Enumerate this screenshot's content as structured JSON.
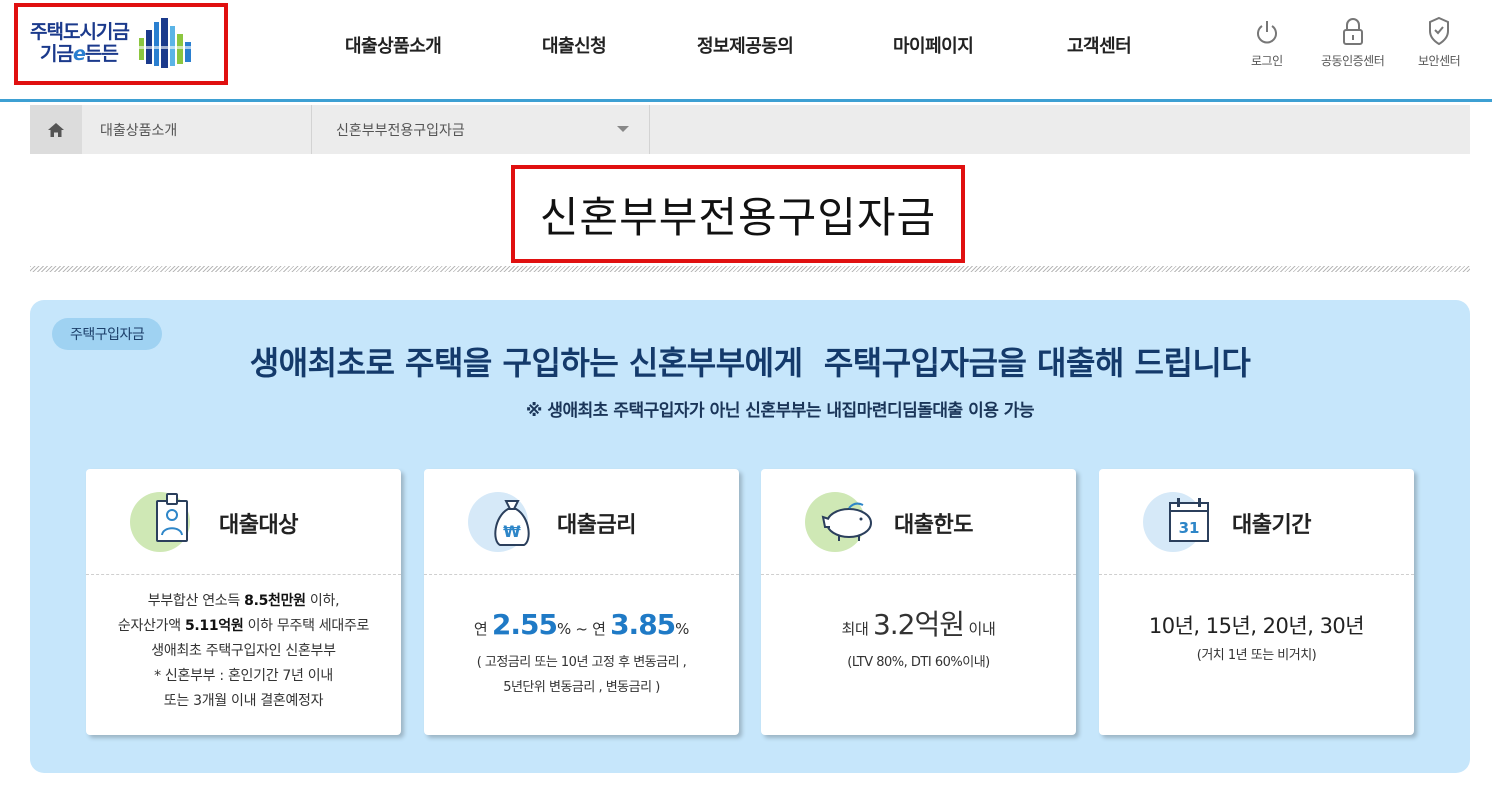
{
  "logo": {
    "line1": "주택도시기금",
    "line2_prefix": "기금",
    "line2_e": "e",
    "line2_suffix": "든든"
  },
  "gnb": [
    "대출상품소개",
    "대출신청",
    "정보제공동의",
    "마이페이지",
    "고객센터"
  ],
  "util": {
    "login": "로그인",
    "cert": "공동인증센터",
    "security": "보안센터"
  },
  "breadcrumb": {
    "level1": "대출상품소개",
    "level2": "신혼부부전용구입자금"
  },
  "page_title": "신혼부부전용구입자금",
  "panel": {
    "tag": "주택구입자금",
    "headline": "생애최초로 주택을 구입하는 신혼부부에게  주택구입자금을 대출해 드립니다",
    "subline": "※ 생애최초 주택구입자가 아닌 신혼부부는 내집마련디딤돌대출 이용 가능"
  },
  "cards": {
    "target": {
      "title": "대출대상",
      "line1_prefix": "부부합산 연소득 ",
      "line1_bold": "8.5천만원",
      "line1_suffix": " 이하,",
      "line2_prefix": "순자산가액 ",
      "line2_bold": "5.11억원",
      "line2_suffix": " 이하 무주택 세대주로",
      "line3": "생애최초 주택구입자인 신혼부부",
      "line4": "* 신혼부부 : 혼인기간 7년 이내",
      "line5": "또는 3개월 이내 결혼예정자"
    },
    "rate": {
      "title": "대출금리",
      "prefix1": "연 ",
      "rate_min": "2.55",
      "unit1": "%",
      "sep": " ~ 연 ",
      "rate_max": "3.85",
      "unit2": "%",
      "note1": "( 고정금리 또는 10년 고정 후 변동금리 ,",
      "note2": "5년단위 변동금리 , 변동금리 )"
    },
    "limit": {
      "title": "대출한도",
      "prefix": "최대 ",
      "amount": "3.2억원",
      "suffix": " 이내",
      "note": "(LTV 80%, DTI 60%이내)"
    },
    "period": {
      "title": "대출기간",
      "terms": "10년, 15년, 20년, 30년",
      "note": "(거치 1년 또는 비거치)",
      "calendar_day": "31"
    }
  },
  "colors": {
    "accent_blue": "#1f7ac6",
    "panel_bg": "#c6e6fb",
    "highlight_red": "#e01010",
    "header_line": "#3ea0d3"
  }
}
